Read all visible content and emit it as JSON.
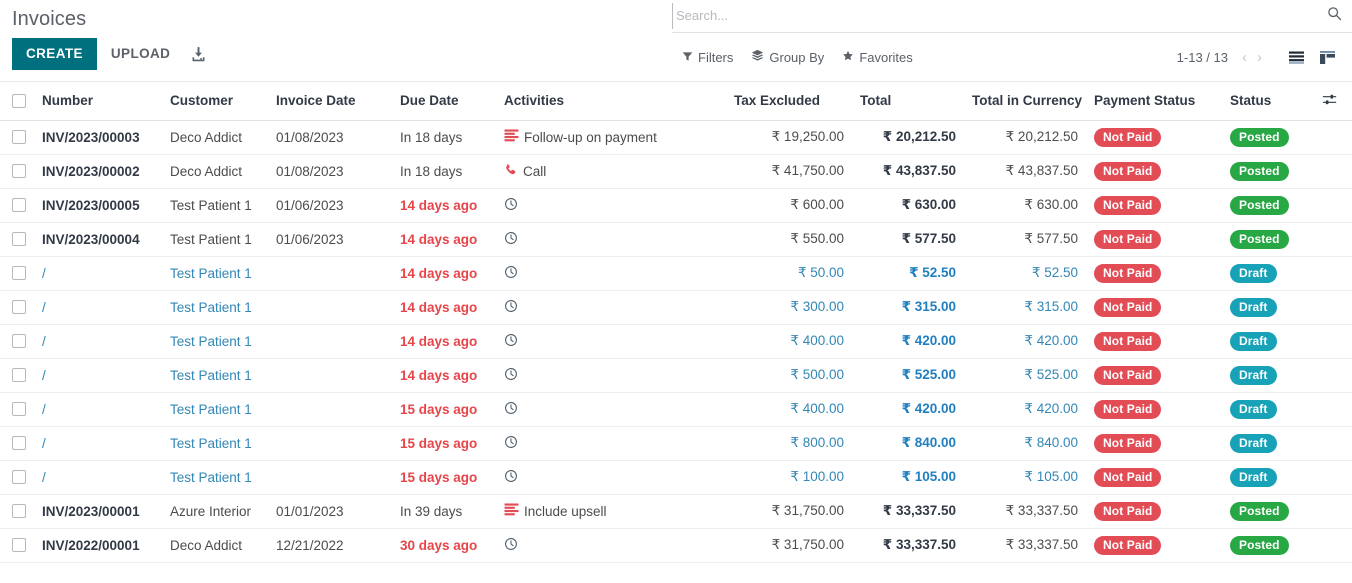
{
  "header": {
    "breadcrumb": "Invoices",
    "create_label": "CREATE",
    "upload_label": "UPLOAD",
    "download_icon": "download-icon"
  },
  "search": {
    "placeholder": "Search...",
    "value": "",
    "search_icon": "search-icon"
  },
  "toolbar": {
    "filters_label": "Filters",
    "group_by_label": "Group By",
    "favorites_label": "Favorites",
    "pager_value": "1-13 / 13",
    "prev_label": "‹",
    "next_label": "›",
    "list_view_icon": "list-view-icon",
    "kanban_view_icon": "kanban-view-icon"
  },
  "table": {
    "columns": [
      {
        "key": "number",
        "label": "Number"
      },
      {
        "key": "customer",
        "label": "Customer"
      },
      {
        "key": "invoice_date",
        "label": "Invoice Date"
      },
      {
        "key": "due_date",
        "label": "Due Date"
      },
      {
        "key": "activities",
        "label": "Activities"
      },
      {
        "key": "tax_excluded",
        "label": "Tax Excluded"
      },
      {
        "key": "total",
        "label": "Total"
      },
      {
        "key": "total_cur",
        "label": "Total in Currency"
      },
      {
        "key": "pay_status",
        "label": "Payment Status"
      },
      {
        "key": "status",
        "label": "Status"
      }
    ],
    "optional_columns_icon": "sliders-icon",
    "rows": [
      {
        "number": "INV/2023/00003",
        "customer": "Deco Addict",
        "invoice_date": "01/08/2023",
        "due_date": "In 18 days",
        "due_overdue": false,
        "activity_icon": "summary-list-icon",
        "activity_label": "Follow-up on payment",
        "tax_excluded": "₹ 19,250.00",
        "total": "₹ 20,212.50",
        "total_cur": "₹ 20,212.50",
        "pay_status": "Not Paid",
        "status": "Posted",
        "draft": false
      },
      {
        "number": "INV/2023/00002",
        "customer": "Deco Addict",
        "invoice_date": "01/08/2023",
        "due_date": "In 18 days",
        "due_overdue": false,
        "activity_icon": "phone-icon",
        "activity_label": "Call",
        "tax_excluded": "₹ 41,750.00",
        "total": "₹ 43,837.50",
        "total_cur": "₹ 43,837.50",
        "pay_status": "Not Paid",
        "status": "Posted",
        "draft": false
      },
      {
        "number": "INV/2023/00005",
        "customer": "Test Patient 1",
        "invoice_date": "01/06/2023",
        "due_date": "14 days ago",
        "due_overdue": true,
        "activity_icon": "clock-icon",
        "activity_label": "",
        "tax_excluded": "₹ 600.00",
        "total": "₹ 630.00",
        "total_cur": "₹ 630.00",
        "pay_status": "Not Paid",
        "status": "Posted",
        "draft": false
      },
      {
        "number": "INV/2023/00004",
        "customer": "Test Patient 1",
        "invoice_date": "01/06/2023",
        "due_date": "14 days ago",
        "due_overdue": true,
        "activity_icon": "clock-icon",
        "activity_label": "",
        "tax_excluded": "₹ 550.00",
        "total": "₹ 577.50",
        "total_cur": "₹ 577.50",
        "pay_status": "Not Paid",
        "status": "Posted",
        "draft": false
      },
      {
        "number": "/",
        "customer": "Test Patient 1",
        "invoice_date": "",
        "due_date": "14 days ago",
        "due_overdue": true,
        "activity_icon": "clock-icon",
        "activity_label": "",
        "tax_excluded": "₹ 50.00",
        "total": "₹ 52.50",
        "total_cur": "₹ 52.50",
        "pay_status": "Not Paid",
        "status": "Draft",
        "draft": true
      },
      {
        "number": "/",
        "customer": "Test Patient 1",
        "invoice_date": "",
        "due_date": "14 days ago",
        "due_overdue": true,
        "activity_icon": "clock-icon",
        "activity_label": "",
        "tax_excluded": "₹ 300.00",
        "total": "₹ 315.00",
        "total_cur": "₹ 315.00",
        "pay_status": "Not Paid",
        "status": "Draft",
        "draft": true
      },
      {
        "number": "/",
        "customer": "Test Patient 1",
        "invoice_date": "",
        "due_date": "14 days ago",
        "due_overdue": true,
        "activity_icon": "clock-icon",
        "activity_label": "",
        "tax_excluded": "₹ 400.00",
        "total": "₹ 420.00",
        "total_cur": "₹ 420.00",
        "pay_status": "Not Paid",
        "status": "Draft",
        "draft": true
      },
      {
        "number": "/",
        "customer": "Test Patient 1",
        "invoice_date": "",
        "due_date": "14 days ago",
        "due_overdue": true,
        "activity_icon": "clock-icon",
        "activity_label": "",
        "tax_excluded": "₹ 500.00",
        "total": "₹ 525.00",
        "total_cur": "₹ 525.00",
        "pay_status": "Not Paid",
        "status": "Draft",
        "draft": true
      },
      {
        "number": "/",
        "customer": "Test Patient 1",
        "invoice_date": "",
        "due_date": "15 days ago",
        "due_overdue": true,
        "activity_icon": "clock-icon",
        "activity_label": "",
        "tax_excluded": "₹ 400.00",
        "total": "₹ 420.00",
        "total_cur": "₹ 420.00",
        "pay_status": "Not Paid",
        "status": "Draft",
        "draft": true
      },
      {
        "number": "/",
        "customer": "Test Patient 1",
        "invoice_date": "",
        "due_date": "15 days ago",
        "due_overdue": true,
        "activity_icon": "clock-icon",
        "activity_label": "",
        "tax_excluded": "₹ 800.00",
        "total": "₹ 840.00",
        "total_cur": "₹ 840.00",
        "pay_status": "Not Paid",
        "status": "Draft",
        "draft": true
      },
      {
        "number": "/",
        "customer": "Test Patient 1",
        "invoice_date": "",
        "due_date": "15 days ago",
        "due_overdue": true,
        "activity_icon": "clock-icon",
        "activity_label": "",
        "tax_excluded": "₹ 100.00",
        "total": "₹ 105.00",
        "total_cur": "₹ 105.00",
        "pay_status": "Not Paid",
        "status": "Draft",
        "draft": true
      },
      {
        "number": "INV/2023/00001",
        "customer": "Azure Interior",
        "invoice_date": "01/01/2023",
        "due_date": "In 39 days",
        "due_overdue": false,
        "activity_icon": "summary-list-icon",
        "activity_label": "Include upsell",
        "tax_excluded": "₹ 31,750.00",
        "total": "₹ 33,337.50",
        "total_cur": "₹ 33,337.50",
        "pay_status": "Not Paid",
        "status": "Posted",
        "draft": false
      },
      {
        "number": "INV/2022/00001",
        "customer": "Deco Addict",
        "invoice_date": "12/21/2022",
        "due_date": "30 days ago",
        "due_overdue": true,
        "activity_icon": "clock-icon",
        "activity_label": "",
        "tax_excluded": "₹ 31,750.00",
        "total": "₹ 33,337.50",
        "total_cur": "₹ 33,337.50",
        "pay_status": "Not Paid",
        "status": "Posted",
        "draft": false
      }
    ]
  },
  "colors": {
    "primary": "#00707f",
    "link": "#3287b5",
    "overdue": "#e6454a",
    "badge_not_paid": "#e24c54",
    "badge_posted": "#28a745",
    "badge_draft": "#17a2b8"
  }
}
